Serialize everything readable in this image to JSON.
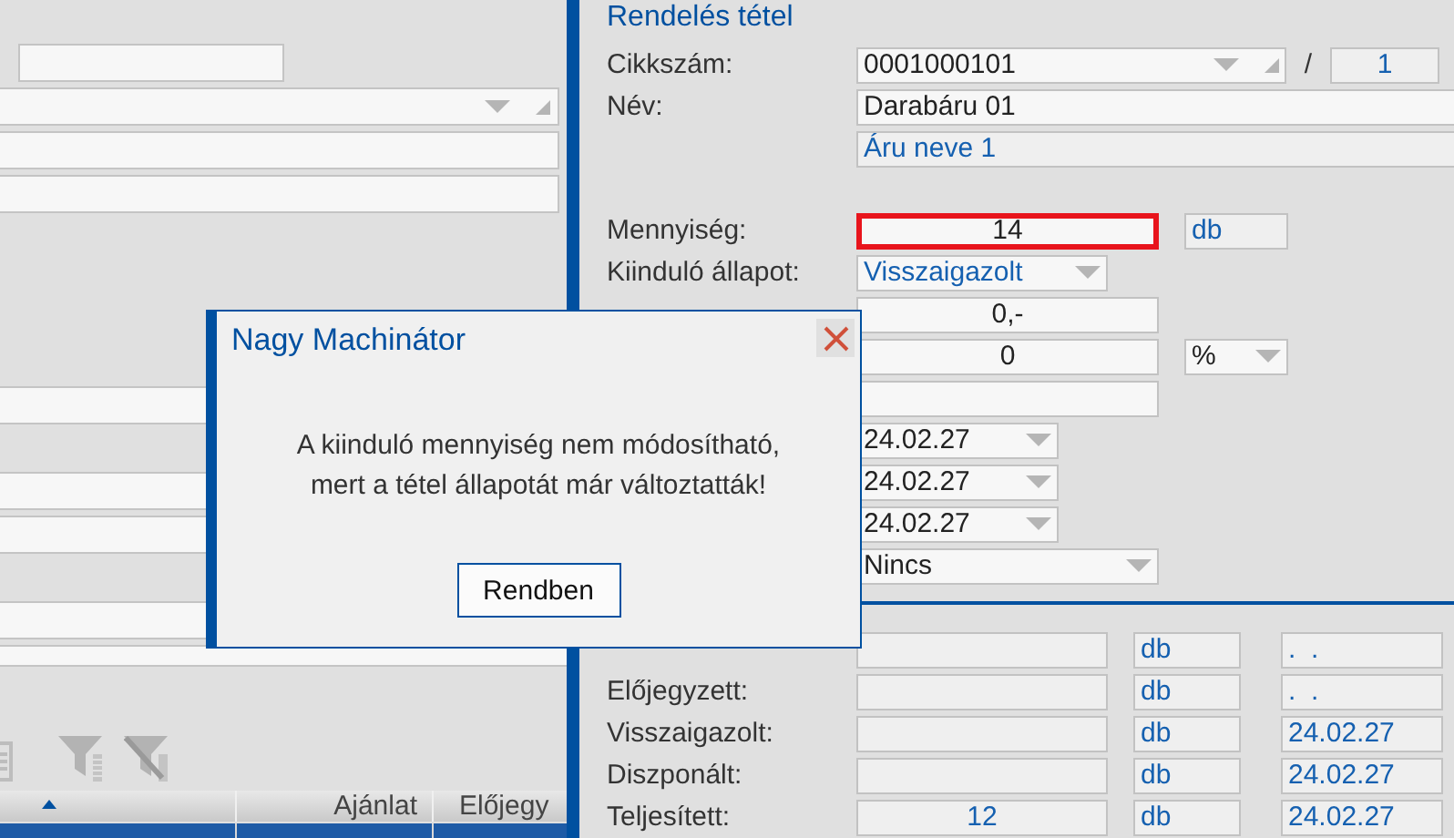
{
  "list_panel": {
    "table": {
      "columns": [
        {
          "sorted": true
        },
        {
          "label": "Ajánlat",
          "sorted": false
        },
        {
          "label": "Előjegy",
          "sorted": false
        }
      ],
      "rows": [
        {
          "selected": true
        }
      ]
    }
  },
  "order_item": {
    "title": "Rendelés tétel",
    "article": {
      "label": "Cikkszám:",
      "value": "0001000101",
      "separator": "/",
      "line": "1"
    },
    "name": {
      "label": "Név:",
      "value": "Darabáru 01",
      "description": "Áru neve 1"
    },
    "quantity": {
      "label": "Mennyiség:",
      "value": "14",
      "unit": "db",
      "error": true
    },
    "initial_status": {
      "label": "Kiinduló állapot:",
      "value": "Visszaigazolt"
    },
    "net_price": {
      "value": "0,-"
    },
    "discount": {
      "value": "0",
      "unit": "%"
    },
    "dates": [
      "24.02.27",
      "24.02.27",
      "24.02.27"
    ],
    "option": {
      "value": "Nincs"
    }
  },
  "status_rows": [
    {
      "unit": "db",
      "date": ".  ."
    },
    {
      "label": "Előjegyzett:",
      "unit": "db",
      "date": ".  ."
    },
    {
      "label": "Visszaigazolt:",
      "unit": "db",
      "date": "24.02.27"
    },
    {
      "label": "Diszponált:",
      "unit": "db",
      "date": "24.02.27"
    },
    {
      "label": "Teljesített:",
      "quantity": "12",
      "unit": "db",
      "date": "24.02.27"
    }
  ],
  "dialog": {
    "title": "Nagy Machinátor",
    "message": [
      "A kiinduló mennyiség nem módosítható,",
      "mert a tétel állapotát már változtatták!"
    ],
    "button": "Rendben"
  }
}
